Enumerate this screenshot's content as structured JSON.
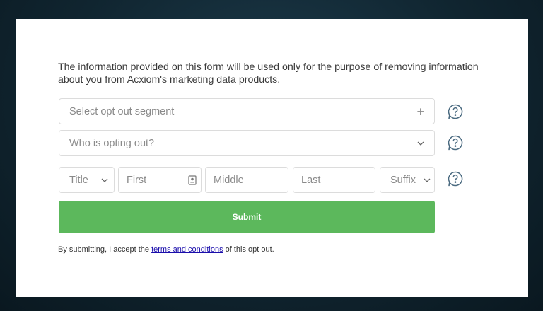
{
  "intro_text": "The information provided on this form will be used only for the purpose of removing information about you from Acxiom's marketing data products.",
  "fields": {
    "segment_placeholder": "Select opt out segment",
    "who_placeholder": "Who is opting out?",
    "title_placeholder": "Title",
    "first_placeholder": "First",
    "middle_placeholder": "Middle",
    "last_placeholder": "Last",
    "suffix_placeholder": "Suffix"
  },
  "submit_label": "Submit",
  "terms": {
    "prefix": "By submitting, I accept the",
    "link": "terms and conditions",
    "suffix": "of this opt out."
  },
  "colors": {
    "submit": "#5cb85c",
    "help_icon": "#4a6a80",
    "link": "#1a0dab"
  },
  "icons": {
    "help": "speech-bubble-question-icon",
    "contact_card": "contact-card-icon",
    "chevron": "chevron-down-icon",
    "plus": "plus-icon"
  }
}
